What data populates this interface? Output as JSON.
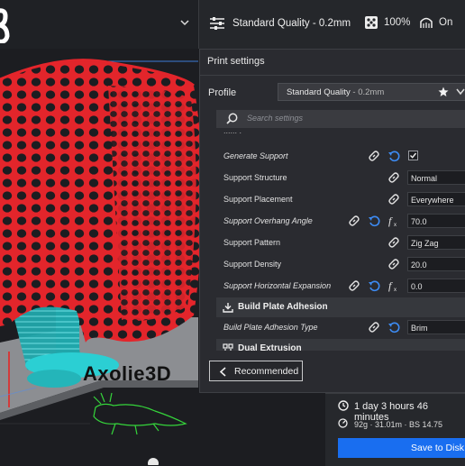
{
  "topbar": {
    "quality": "Standard Quality - 0.2mm",
    "infill": "100%",
    "support": "On"
  },
  "panel": {
    "title": "Print settings",
    "profile_label": "Profile",
    "profile_name": "Standard Quality",
    "profile_version": " - 0.2mm",
    "search_placeholder": "Search settings",
    "partial_label": "...... .",
    "rows": [
      {
        "label": "Generate Support",
        "value": "",
        "checked": true
      },
      {
        "label": "Support Structure",
        "value": "Normal"
      },
      {
        "label": "Support Placement",
        "value": "Everywhere"
      },
      {
        "label": "Support Overhang Angle",
        "value": "70.0"
      },
      {
        "label": "Support Pattern",
        "value": "Zig Zag"
      },
      {
        "label": "Support Density",
        "value": "20.0"
      },
      {
        "label": "Support Horizontal Expansion",
        "value": "0.0"
      },
      {
        "label": "Build Plate Adhesion Type",
        "value": "Brim"
      }
    ],
    "categories": {
      "adhesion": "Build Plate Adhesion",
      "dual": "Dual Extrusion"
    },
    "recommended": "Recommended"
  },
  "viewport": {
    "logo_text": "Axolie3D"
  },
  "output": {
    "time": "1 day 3 hours 46 minutes",
    "material": "92g · 31.01m · BS 14.75",
    "save": "Save to Disk"
  },
  "colors": {
    "model": "#e3252b",
    "support": "#29c4c8",
    "accent": "#196ef0",
    "panel": "#2a2b30"
  }
}
